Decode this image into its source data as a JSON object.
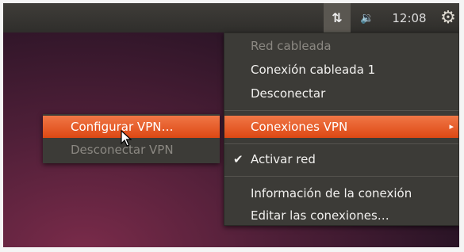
{
  "topbar": {
    "network_icon": "network-updown-icon",
    "network_glyph": "⇅",
    "volume_icon": "speaker-icon",
    "volume_glyph": "🔉",
    "time": "12:08",
    "session_icon": "gear-icon",
    "session_glyph": "⚙"
  },
  "menu": {
    "wired_header": "Red cableada",
    "wired_connection": "Conexión cableada 1",
    "disconnect": "Desconectar",
    "vpn_connections": "Conexiones VPN",
    "submenu_arrow": "▸",
    "enable_network_check": "✔",
    "enable_network": "Activar red",
    "connection_info": "Información de la conexión",
    "edit_connections": "Editar las conexiones…"
  },
  "submenu": {
    "configure_vpn": "Configurar VPN…",
    "disconnect_vpn": "Desconectar VPN"
  },
  "colors": {
    "highlight": "#dd4814",
    "panel": "#3c3b37"
  }
}
